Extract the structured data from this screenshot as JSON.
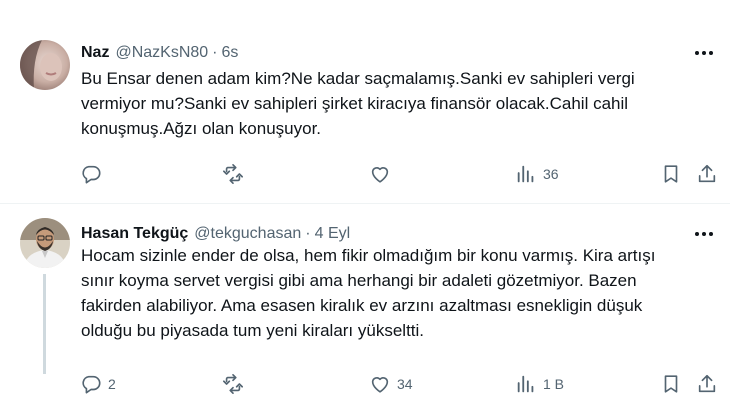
{
  "tweets": [
    {
      "name": "Naz",
      "handle": "@NazKsN80",
      "separator": "·",
      "time": "6s",
      "lines": [
        "Bu Ensar denen adam kim?Ne kadar saçmalamış.Sanki ev sahipleri vergi",
        "vermiyor mu?Sanki ev sahipleri şirket kiracıya finansör olacak.Cahil cahil",
        "konuşmuş.Ağzı olan konuşuyor."
      ],
      "reply_count": "",
      "retweet_count": "",
      "like_count": "",
      "view_count": "36",
      "icons": [
        "avatar",
        "more-icon",
        "reply-icon",
        "retweet-icon",
        "like-icon",
        "views-icon",
        "bookmark-icon",
        "share-icon"
      ]
    },
    {
      "name": "Hasan Tekgüç",
      "handle": "@tekguchasan",
      "separator": "·",
      "time": "4 Eyl",
      "lines": [
        "Hocam sizinle ender de olsa, hem fikir olmadığım bir konu varmış. Kira artışı",
        "sınır koyma servet vergisi gibi ama herhangi bir adaleti gözetmiyor. Bazen",
        "fakirden alabiliyor. Ama esasen kiralık ev arzını azaltması esnekligin düşuk",
        "olduğu bu piyasada tum yeni kiraları yükseltti."
      ],
      "reply_count": "2",
      "retweet_count": "",
      "like_count": "34",
      "view_count": "1 B",
      "icons": [
        "avatar",
        "more-icon",
        "reply-icon",
        "retweet-icon",
        "like-icon",
        "views-icon",
        "bookmark-icon",
        "share-icon"
      ]
    }
  ],
  "colors": {
    "text": "#0f1419",
    "secondary": "#536471",
    "divider": "#eff3f4",
    "thread_line": "#cfd9de"
  }
}
